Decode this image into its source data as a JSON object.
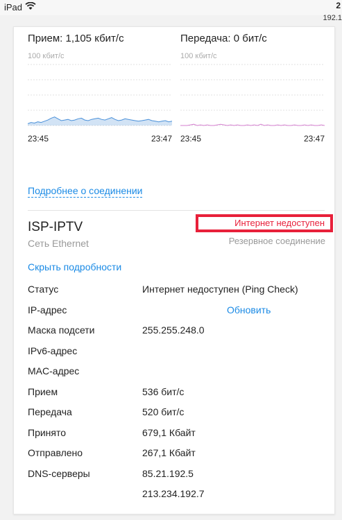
{
  "statusbar": {
    "device": "iPad",
    "time": "2",
    "ip": "192.1"
  },
  "charts": {
    "rx": {
      "title": "Прием: 1,105 кбит/с",
      "scale": "100 кбит/с",
      "time_start": "23:45",
      "time_end": "23:47",
      "color": "#4a90d9"
    },
    "tx": {
      "title": "Передача: 0 бит/с",
      "scale": "100 кбит/с",
      "time_start": "23:45",
      "time_end": "23:47",
      "color": "#d47fcf"
    }
  },
  "chart_data": [
    {
      "type": "area",
      "title": "Прием: 1,105 кбит/с",
      "ylabel": "100 кбит/с",
      "xlabel": "",
      "x_range": [
        "23:45",
        "23:47"
      ],
      "ylim": [
        0,
        100
      ],
      "series": [
        {
          "values": [
            3,
            5,
            4,
            6,
            5,
            7,
            9,
            12,
            14,
            11,
            8,
            9,
            10,
            8,
            9,
            11,
            12,
            9,
            8,
            10,
            11,
            12,
            10,
            9,
            11,
            13,
            10,
            8,
            9,
            11,
            10,
            9,
            8,
            7,
            8,
            9,
            10,
            8,
            7,
            6,
            7,
            8,
            6,
            7
          ]
        }
      ]
    },
    {
      "type": "line",
      "title": "Передача: 0 бит/с",
      "ylabel": "100 кбит/с",
      "xlabel": "",
      "x_range": [
        "23:45",
        "23:47"
      ],
      "ylim": [
        0,
        100
      ],
      "series": [
        {
          "values": [
            0,
            0,
            0,
            1,
            2,
            0,
            1,
            0,
            1,
            0,
            0,
            1,
            2,
            1,
            0,
            1,
            0,
            1,
            0,
            0,
            1,
            0,
            1,
            0,
            2,
            0,
            1,
            0,
            0,
            1,
            0,
            1,
            0,
            0,
            1,
            0,
            0,
            1,
            0,
            1,
            0,
            0,
            1,
            0
          ]
        }
      ]
    }
  ],
  "links": {
    "more": "Подробнее о соединении",
    "hide": "Скрыть подробности"
  },
  "interface": {
    "name": "ISP-IPTV",
    "type": "Сеть Ethernet",
    "status": "Интернет недоступен",
    "backup": "Резервное соединение",
    "status_color": "#e8203a"
  },
  "details": {
    "status_label": "Статус",
    "status_value": "Интернет недоступен (Ping Check)",
    "ip_label": "IP-адрес",
    "ip_value": "",
    "refresh": "Обновить",
    "mask_label": "Маска подсети",
    "mask_value": "255.255.248.0",
    "ipv6_label": "IPv6-адрес",
    "ipv6_value": "",
    "mac_label": "MAC-адрес",
    "mac_value": "",
    "rx_label": "Прием",
    "rx_value": "536 бит/с",
    "tx_label": "Передача",
    "tx_value": "520 бит/с",
    "recv_label": "Принято",
    "recv_value": "679,1 Кбайт",
    "sent_label": "Отправлено",
    "sent_value": "267,1 Кбайт",
    "dns_label": "DNS-серверы",
    "dns_1": "85.21.192.5",
    "dns_2": "213.234.192.7"
  }
}
